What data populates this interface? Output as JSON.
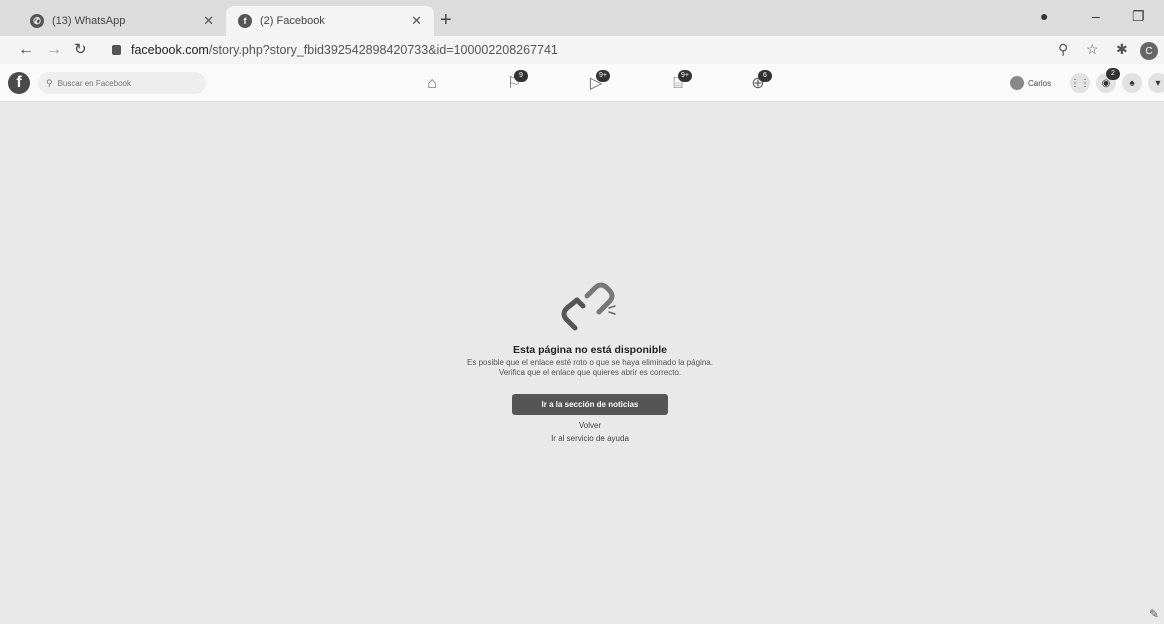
{
  "browser": {
    "tabs": [
      {
        "title": "(13) WhatsApp",
        "favicon": "whatsapp-icon",
        "active": false
      },
      {
        "title": "(2) Facebook",
        "favicon": "facebook-icon",
        "active": true
      }
    ],
    "url_host": "facebook.com",
    "url_path": "/story.php?story_fbid392542898420733&id=100002208267741"
  },
  "facebook": {
    "search_placeholder": "Buscar en Facebook",
    "nav": [
      {
        "name": "home-icon",
        "badge": ""
      },
      {
        "name": "flag-icon",
        "badge": "9"
      },
      {
        "name": "video-icon",
        "badge": "9+"
      },
      {
        "name": "marketplace-icon",
        "badge": "9+"
      },
      {
        "name": "groups-icon",
        "badge": "6"
      }
    ],
    "user_name": "Carlos",
    "messenger_badge": "2"
  },
  "error": {
    "title": "Esta página no está disponible",
    "message": "Es posible que el enlace esté roto o que se haya eliminado la página. Verifica que el enlace que quieres abrir es correcto.",
    "primary_button": "Ir a la sección de noticias",
    "back_link": "Volver",
    "help_link": "Ir al servicio de ayuda"
  }
}
